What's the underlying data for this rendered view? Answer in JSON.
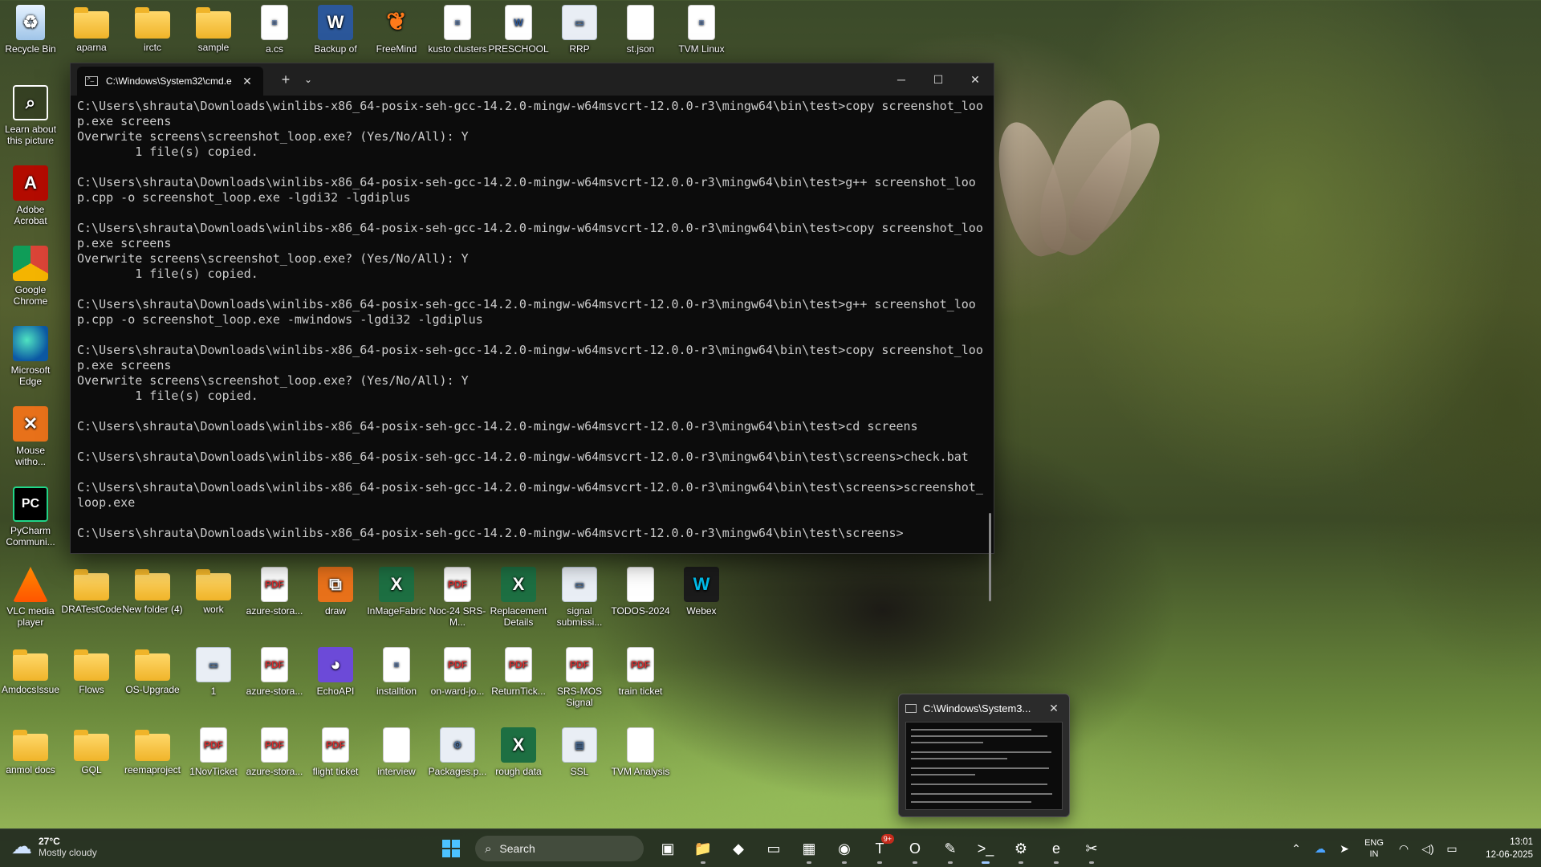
{
  "desktop_icons": [
    {
      "id": "recycle-bin",
      "label": "Recycle Bin",
      "glyph": "♻",
      "kind": "g-bin"
    },
    {
      "id": "aparna",
      "label": "aparna",
      "glyph": "",
      "kind": "g-folder"
    },
    {
      "id": "irctc",
      "label": "irctc",
      "glyph": "",
      "kind": "g-folder"
    },
    {
      "id": "sample",
      "label": "sample",
      "glyph": "",
      "kind": "g-folder"
    },
    {
      "id": "a-cs",
      "label": "a.cs",
      "glyph": "≡",
      "kind": "g-doc"
    },
    {
      "id": "backup-of",
      "label": "Backup of",
      "glyph": "W",
      "kind": "g-word"
    },
    {
      "id": "freemind",
      "label": "FreeMind",
      "glyph": "❦",
      "kind": "g-butterfly"
    },
    {
      "id": "kusto-clusters",
      "label": "kusto clusters",
      "glyph": "≡",
      "kind": "g-doc"
    },
    {
      "id": "preschool",
      "label": "PRESCHOOL",
      "glyph": "W",
      "kind": "g-doc"
    },
    {
      "id": "rrp",
      "label": "RRP",
      "glyph": "▭",
      "kind": "g-generic"
    },
    {
      "id": "st-json",
      "label": "st.json",
      "glyph": "",
      "kind": "g-doc"
    },
    {
      "id": "tvm-linux",
      "label": "TVM Linux",
      "glyph": "≡",
      "kind": "g-doc"
    },
    {
      "id": "learn-about",
      "label": "Learn about this picture",
      "glyph": "⌕",
      "kind": "g-circle"
    },
    {
      "id": "adobe-acrobat",
      "label": "Adobe Acrobat",
      "glyph": "A",
      "kind": "g-red"
    },
    {
      "id": "google-chrome",
      "label": "Google Chrome",
      "glyph": "",
      "kind": "g-chrome"
    },
    {
      "id": "microsoft-edge",
      "label": "Microsoft Edge",
      "glyph": "",
      "kind": "g-edge"
    },
    {
      "id": "mouse-without",
      "label": "Mouse witho...",
      "glyph": "✕",
      "kind": "g-orange"
    },
    {
      "id": "pycharm",
      "label": "PyCharm Communi...",
      "glyph": "PC",
      "kind": "g-pc"
    },
    {
      "id": "vlc",
      "label": "VLC media player",
      "glyph": "",
      "kind": "g-vlc"
    },
    {
      "id": "dratestcode",
      "label": "DRATestCode",
      "glyph": "",
      "kind": "g-folder"
    },
    {
      "id": "new-folder-4",
      "label": "New folder (4)",
      "glyph": "",
      "kind": "g-folder"
    },
    {
      "id": "work",
      "label": "work",
      "glyph": "",
      "kind": "g-folder"
    },
    {
      "id": "azure-stora-1",
      "label": "azure-stora...",
      "glyph": "PDF",
      "kind": "g-pdf"
    },
    {
      "id": "draw",
      "label": "draw",
      "glyph": "⧉",
      "kind": "g-orange"
    },
    {
      "id": "inmagefabric",
      "label": "InMageFabric",
      "glyph": "X",
      "kind": "g-excel"
    },
    {
      "id": "noc-24",
      "label": "Noc-24 SRS-M...",
      "glyph": "PDF",
      "kind": "g-pdf"
    },
    {
      "id": "replacement-details",
      "label": "Replacement Details",
      "glyph": "X",
      "kind": "g-excel"
    },
    {
      "id": "signal-submissi",
      "label": "signal submissi...",
      "glyph": "▭",
      "kind": "g-generic"
    },
    {
      "id": "todos-2024",
      "label": "TODOS-2024",
      "glyph": "",
      "kind": "g-doc"
    },
    {
      "id": "webex",
      "label": "Webex",
      "glyph": "W",
      "kind": "g-webex"
    },
    {
      "id": "amdocsissue",
      "label": "AmdocsIssue",
      "glyph": "",
      "kind": "g-folder"
    },
    {
      "id": "flows",
      "label": "Flows",
      "glyph": "",
      "kind": "g-folder"
    },
    {
      "id": "os-upgrade",
      "label": "OS-Upgrade",
      "glyph": "",
      "kind": "g-folder"
    },
    {
      "id": "one",
      "label": "1",
      "glyph": "▭",
      "kind": "g-generic"
    },
    {
      "id": "azure-stora-2",
      "label": "azure-stora...",
      "glyph": "PDF",
      "kind": "g-pdf"
    },
    {
      "id": "echoapi",
      "label": "EchoAPI",
      "glyph": "◕",
      "kind": "g-purple"
    },
    {
      "id": "installtion",
      "label": "installtion",
      "glyph": "≡",
      "kind": "g-doc"
    },
    {
      "id": "on-ward-jo",
      "label": "on-ward-jo...",
      "glyph": "PDF",
      "kind": "g-pdf"
    },
    {
      "id": "returntick",
      "label": "ReturnTick...",
      "glyph": "PDF",
      "kind": "g-pdf"
    },
    {
      "id": "srs-mos-signal",
      "label": "SRS-MOS Signal",
      "glyph": "PDF",
      "kind": "g-pdf"
    },
    {
      "id": "train-ticket",
      "label": "train ticket",
      "glyph": "PDF",
      "kind": "g-pdf"
    },
    {
      "id": "anmol-docs",
      "label": "anmol docs",
      "glyph": "",
      "kind": "g-folder"
    },
    {
      "id": "gql",
      "label": "GQL",
      "glyph": "",
      "kind": "g-folder"
    },
    {
      "id": "reemaproject",
      "label": "reemaproject",
      "glyph": "",
      "kind": "g-folder"
    },
    {
      "id": "1novticket",
      "label": "1NovTicket",
      "glyph": "PDF",
      "kind": "g-pdf"
    },
    {
      "id": "azure-stora-3",
      "label": "azure-stora...",
      "glyph": "PDF",
      "kind": "g-pdf"
    },
    {
      "id": "flight-ticket",
      "label": "flight ticket",
      "glyph": "PDF",
      "kind": "g-pdf"
    },
    {
      "id": "interview",
      "label": "interview",
      "glyph": "",
      "kind": "g-doc"
    },
    {
      "id": "packages-p",
      "label": "Packages.p...",
      "glyph": "⚙",
      "kind": "g-generic"
    },
    {
      "id": "rough-data",
      "label": "rough data",
      "glyph": "X",
      "kind": "g-excel"
    },
    {
      "id": "ssl",
      "label": "SSL",
      "glyph": "▤",
      "kind": "g-generic"
    },
    {
      "id": "tvm-analysis",
      "label": "TVM Analysis",
      "glyph": "",
      "kind": "g-doc"
    }
  ],
  "cmd": {
    "tab_title": "C:\\Windows\\System32\\cmd.e",
    "tab_close": "✕",
    "new_tab": "+",
    "dropdown": "⌄",
    "minimize": "─",
    "maximize": "☐",
    "close": "✕",
    "lines": [
      "C:\\Users\\shrauta\\Downloads\\winlibs-x86_64-posix-seh-gcc-14.2.0-mingw-w64msvcrt-12.0.0-r3\\mingw64\\bin\\test>copy screenshot_loop.exe screens",
      "Overwrite screens\\screenshot_loop.exe? (Yes/No/All): Y",
      "        1 file(s) copied.",
      "",
      "C:\\Users\\shrauta\\Downloads\\winlibs-x86_64-posix-seh-gcc-14.2.0-mingw-w64msvcrt-12.0.0-r3\\mingw64\\bin\\test>g++ screenshot_loop.cpp -o screenshot_loop.exe -lgdi32 -lgdiplus",
      "",
      "C:\\Users\\shrauta\\Downloads\\winlibs-x86_64-posix-seh-gcc-14.2.0-mingw-w64msvcrt-12.0.0-r3\\mingw64\\bin\\test>copy screenshot_loop.exe screens",
      "Overwrite screens\\screenshot_loop.exe? (Yes/No/All): Y",
      "        1 file(s) copied.",
      "",
      "C:\\Users\\shrauta\\Downloads\\winlibs-x86_64-posix-seh-gcc-14.2.0-mingw-w64msvcrt-12.0.0-r3\\mingw64\\bin\\test>g++ screenshot_loop.cpp -o screenshot_loop.exe -mwindows -lgdi32 -lgdiplus",
      "",
      "C:\\Users\\shrauta\\Downloads\\winlibs-x86_64-posix-seh-gcc-14.2.0-mingw-w64msvcrt-12.0.0-r3\\mingw64\\bin\\test>copy screenshot_loop.exe screens",
      "Overwrite screens\\screenshot_loop.exe? (Yes/No/All): Y",
      "        1 file(s) copied.",
      "",
      "C:\\Users\\shrauta\\Downloads\\winlibs-x86_64-posix-seh-gcc-14.2.0-mingw-w64msvcrt-12.0.0-r3\\mingw64\\bin\\test>cd screens",
      "",
      "C:\\Users\\shrauta\\Downloads\\winlibs-x86_64-posix-seh-gcc-14.2.0-mingw-w64msvcrt-12.0.0-r3\\mingw64\\bin\\test\\screens>check.bat",
      "",
      "C:\\Users\\shrauta\\Downloads\\winlibs-x86_64-posix-seh-gcc-14.2.0-mingw-w64msvcrt-12.0.0-r3\\mingw64\\bin\\test\\screens>screenshot_loop.exe",
      "",
      "C:\\Users\\shrauta\\Downloads\\winlibs-x86_64-posix-seh-gcc-14.2.0-mingw-w64msvcrt-12.0.0-r3\\mingw64\\bin\\test\\screens>"
    ]
  },
  "preview": {
    "title": "C:\\Windows\\System3...",
    "close": "✕"
  },
  "taskbar": {
    "weather_temp": "27°C",
    "weather_desc": "Mostly cloudy",
    "search_placeholder": "Search",
    "teams_badge": "9+",
    "apps": [
      {
        "id": "task-view",
        "glyph": "▣",
        "state": ""
      },
      {
        "id": "file-explorer",
        "glyph": "📁",
        "state": "open"
      },
      {
        "id": "copilot",
        "glyph": "◆",
        "state": ""
      },
      {
        "id": "window-app",
        "glyph": "▭",
        "state": ""
      },
      {
        "id": "photo-app",
        "glyph": "▦",
        "state": "open"
      },
      {
        "id": "chrome",
        "glyph": "◉",
        "state": "open"
      },
      {
        "id": "teams",
        "glyph": "T",
        "state": "open"
      },
      {
        "id": "outlook",
        "glyph": "O",
        "state": "open"
      },
      {
        "id": "notepad",
        "glyph": "✎",
        "state": "open"
      },
      {
        "id": "terminal",
        "glyph": ">_",
        "state": "active"
      },
      {
        "id": "settings",
        "glyph": "⚙",
        "state": "open"
      },
      {
        "id": "edge",
        "glyph": "e",
        "state": "open"
      },
      {
        "id": "snipping-tool",
        "glyph": "✂",
        "state": "open"
      }
    ],
    "tray": {
      "lang_top": "ENG",
      "lang_bottom": "IN",
      "time": "13:01",
      "date": "12-06-2025"
    }
  }
}
